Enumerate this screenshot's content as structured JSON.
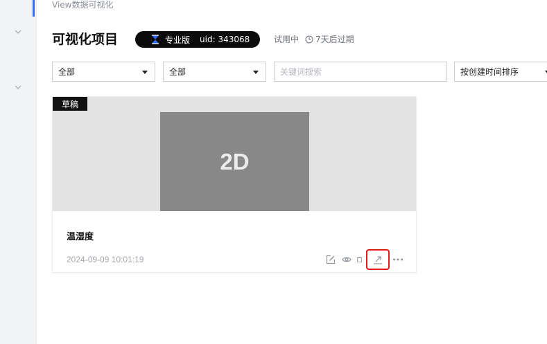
{
  "breadcrumb": "View数据可视化",
  "page_title": "可视化项目",
  "badge": {
    "plan": "专业版",
    "uid": "uid: 343068",
    "icon": "hourglass-icon"
  },
  "trial": {
    "status": "试用中",
    "expiry": "7天后过期"
  },
  "filters": {
    "filter1": "全部",
    "filter2": "全部",
    "search_placeholder": "关键词搜索",
    "sort": "按创建时间排序"
  },
  "projects": [
    {
      "tag": "草稿",
      "thumbnail_label": "2D",
      "name": "温湿度",
      "created": "2024-09-09 10:01:19"
    }
  ],
  "colors": {
    "accent": "#2f6bff",
    "highlight": "#e21a1a",
    "badge_bg": "#0b0b0b"
  }
}
